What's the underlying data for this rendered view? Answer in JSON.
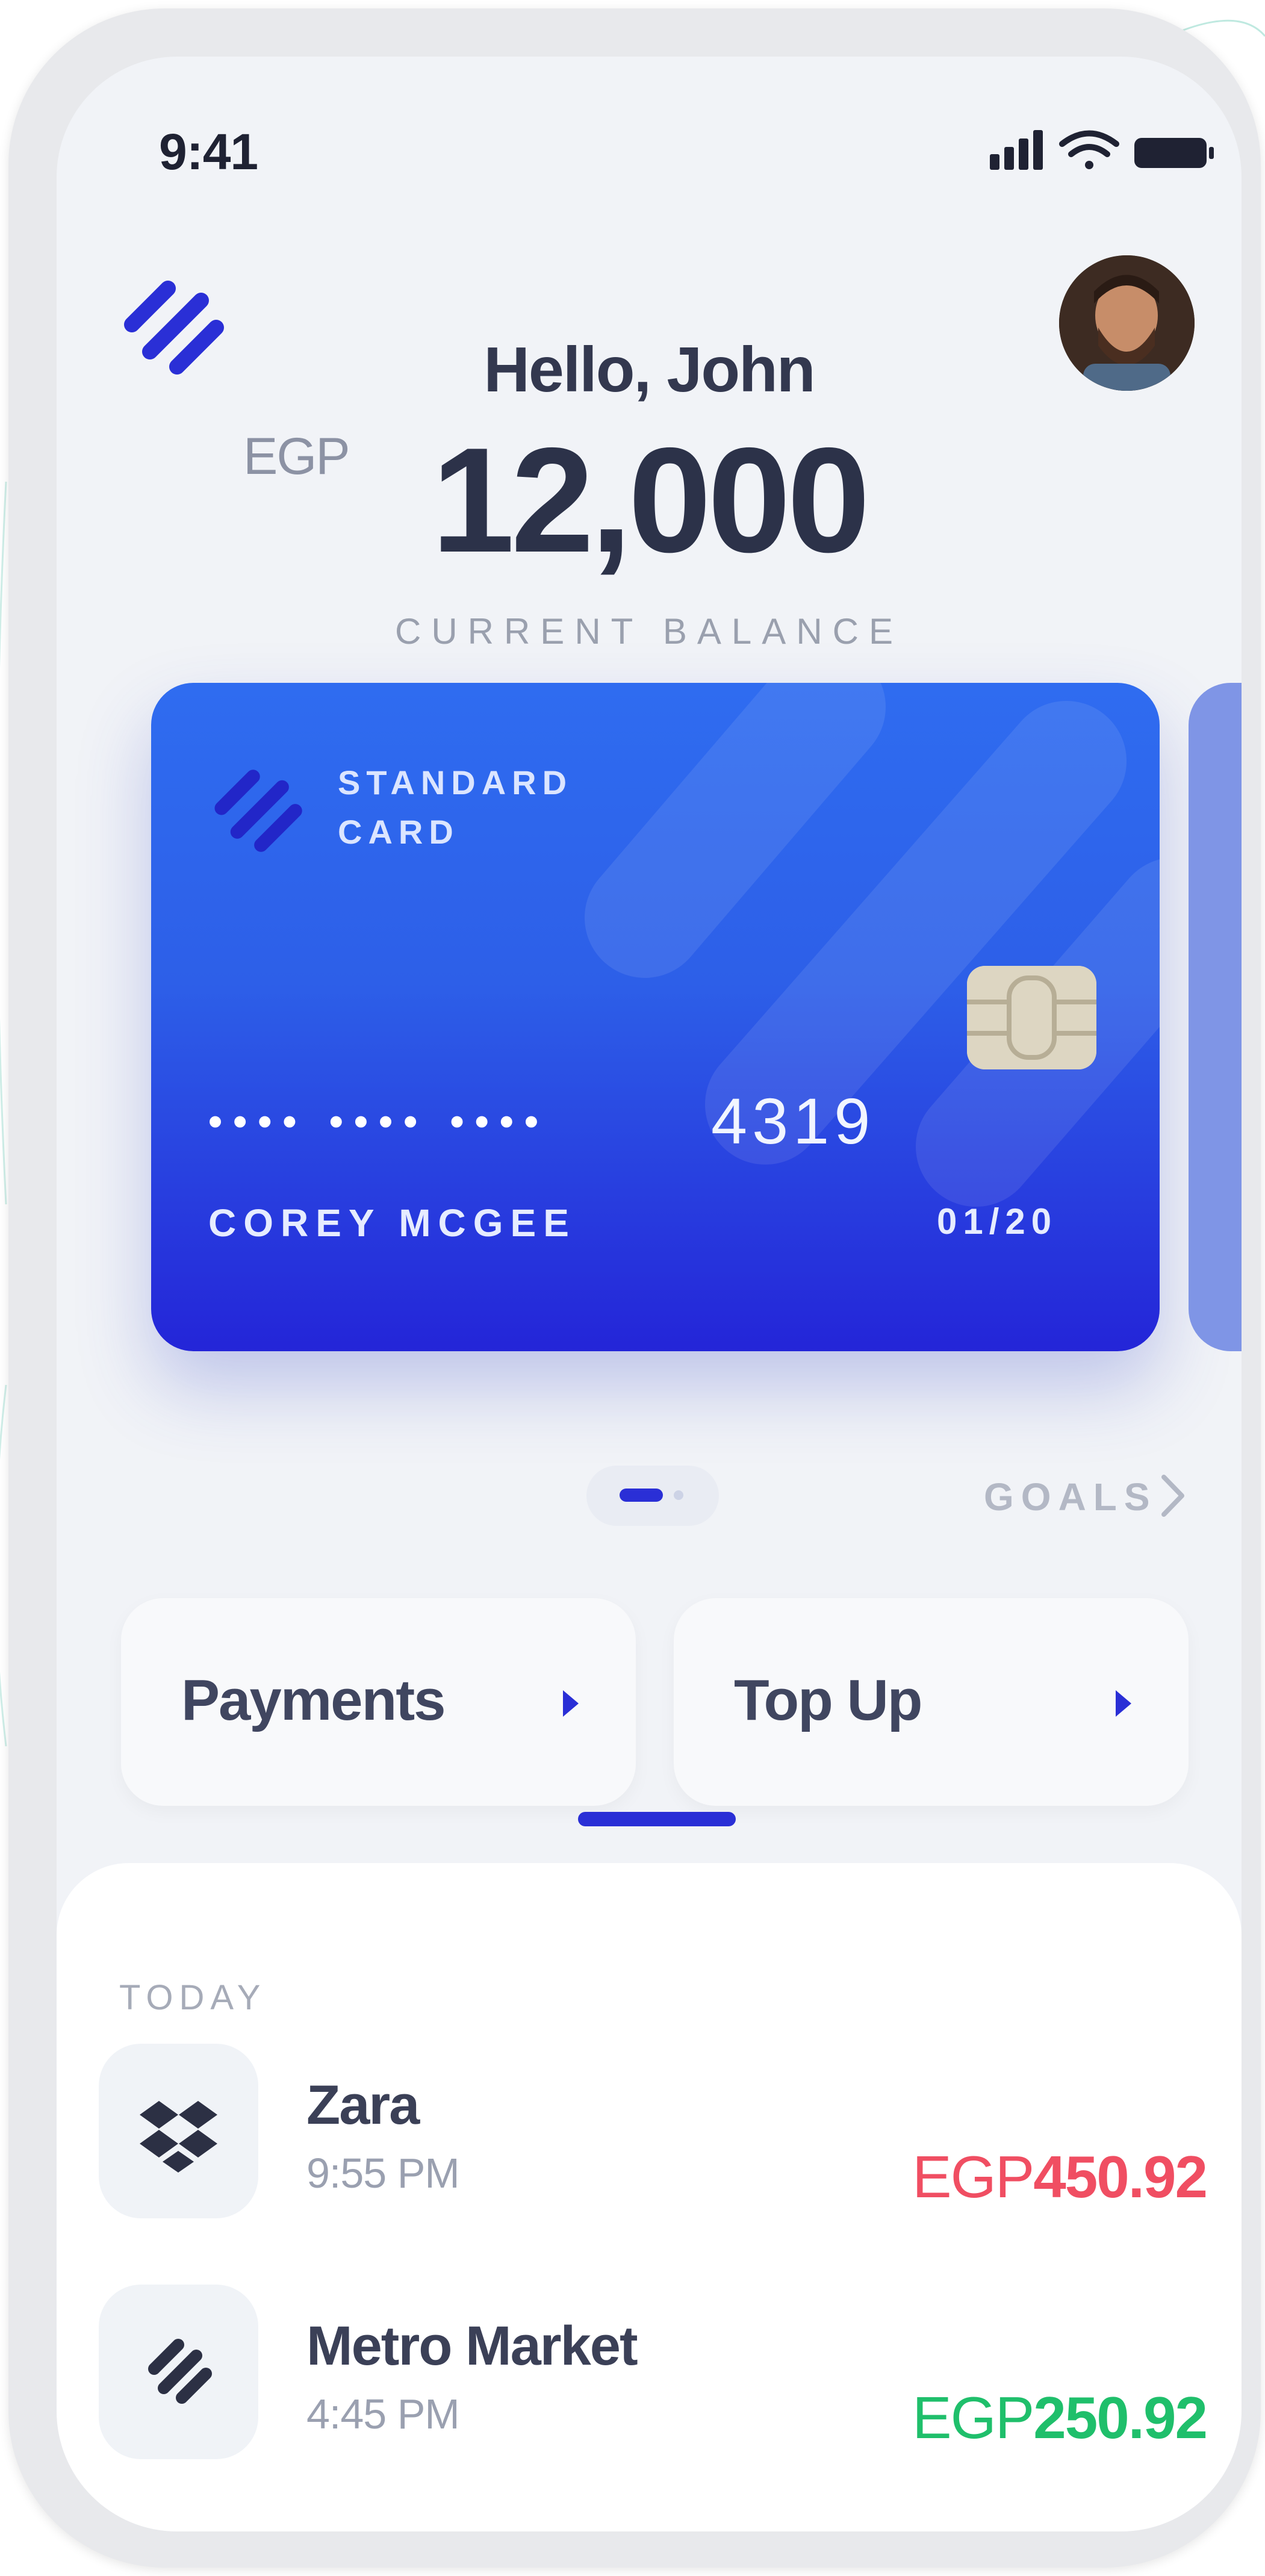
{
  "status_bar": {
    "time": "9:41"
  },
  "header": {
    "greeting": "Hello, John",
    "currency": "EGP",
    "balance": "12,000",
    "balance_label": "CURRENT BALANCE"
  },
  "card": {
    "type_line1": "STANDARD",
    "type_line2": "CARD",
    "masked_number": "•••• •••• ••••",
    "last4": "4319",
    "holder": "COREY MCGEE",
    "expiry": "01/20"
  },
  "carousel": {
    "active_index": 0,
    "goals_label": "GOALS"
  },
  "actions": [
    {
      "label": "Payments",
      "icon": "chevron-right-icon"
    },
    {
      "label": "Top Up",
      "icon": "chevron-right-icon"
    }
  ],
  "transactions": {
    "section_label": "TODAY",
    "items": [
      {
        "name": "Zara",
        "time": "9:55 PM",
        "currency": "EGP",
        "amount": "450.92",
        "icon": "dropbox-icon",
        "color": "#f04e62"
      },
      {
        "name": "Metro Market",
        "time": "4:45 PM",
        "currency": "EGP",
        "amount": "250.92",
        "icon": "brand-logo-icon",
        "color": "#1fbf6b"
      }
    ]
  },
  "colors": {
    "accent": "#2a2fd6",
    "card_top": "#2f6cf0",
    "card_bottom": "#2425d8",
    "debit": "#f04e62",
    "credit": "#1fbf6b"
  }
}
